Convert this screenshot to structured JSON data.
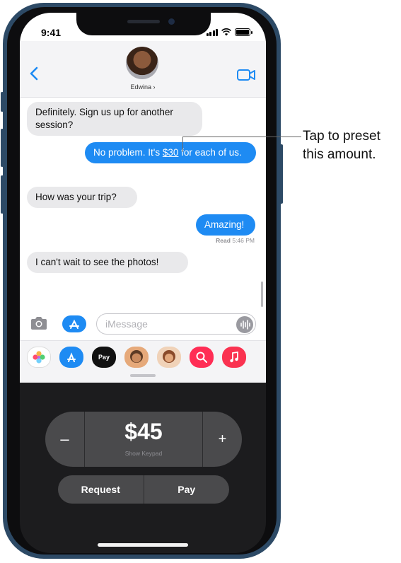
{
  "status": {
    "time": "9:41"
  },
  "contact": {
    "name": "Edwina ›"
  },
  "messages": {
    "m1": "Definitely. Sign us up for another session?",
    "m2_pre": "No problem. It's ",
    "m2_amount": "$30",
    "m2_post": " for each of us.",
    "m3": "How was your trip?",
    "m4": "Amazing!",
    "read_label": "Read",
    "read_time": "5:46 PM",
    "m5": "I can't wait to see the photos!"
  },
  "compose": {
    "placeholder": "iMessage"
  },
  "app_drawer": {
    "apps": [
      "photos",
      "app-store",
      "apple-pay",
      "memoji-1",
      "memoji-2",
      "search-images",
      "music"
    ],
    "apple_pay_label": "Pay"
  },
  "apple_pay": {
    "minus_label": "–",
    "amount": "$45",
    "show_keypad": "Show Keypad",
    "plus_label": "+",
    "request_label": "Request",
    "pay_label": "Pay"
  },
  "callout": {
    "line1": "Tap to preset",
    "line2": "this amount."
  },
  "colors": {
    "imessage_blue": "#1e8bf3",
    "incoming_bubble": "#e9e9eb",
    "pay_panel_bg": "#1c1c1e",
    "pay_control": "#4a4a4c",
    "phone_frame": "#2d4a66"
  }
}
